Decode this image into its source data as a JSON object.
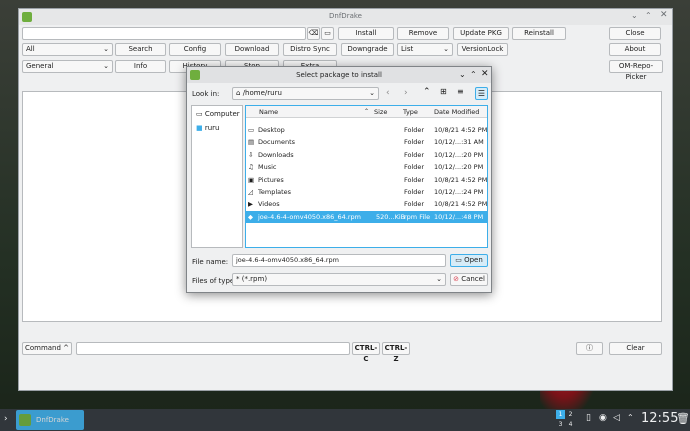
{
  "window": {
    "title": "DnfDrake"
  },
  "toolbar": {
    "install": "Install",
    "remove": "Remove",
    "update_pkg": "Update PKG",
    "reinstall": "Reinstall",
    "close": "Close",
    "about": "About",
    "search": "Search",
    "config": "Config",
    "download": "Download",
    "distro_sync": "Distro Sync",
    "downgrade": "Downgrade",
    "versionlock": "VersionLock",
    "info": "Info",
    "history": "History",
    "stop": "Stop",
    "extra": "Extra",
    "om_repo_picker": "OM-Repo-Picker",
    "filter_all": "All",
    "filter_general": "General",
    "filter_list": "List"
  },
  "bottom": {
    "command": "Command ^",
    "ctrl_c": "CTRL-C",
    "ctrl_z": "CTRL-Z",
    "clear": "Clear"
  },
  "dialog": {
    "title": "Select package to install",
    "look_in_label": "Look in:",
    "look_in_value": "/home/ruru",
    "places": [
      {
        "label": "Computer"
      },
      {
        "label": "ruru"
      }
    ],
    "columns": {
      "name": "Name",
      "size": "Size",
      "type": "Type",
      "date": "Date Modified"
    },
    "files": [
      {
        "name": "Desktop",
        "size": "",
        "type": "Folder",
        "date": "10/8/21 4:52 PM",
        "icon": "desktop-icon"
      },
      {
        "name": "Documents",
        "size": "",
        "type": "Folder",
        "date": "10/12/...:31 AM",
        "icon": "documents-icon"
      },
      {
        "name": "Downloads",
        "size": "",
        "type": "Folder",
        "date": "10/12/...:20 PM",
        "icon": "downloads-icon"
      },
      {
        "name": "Music",
        "size": "",
        "type": "Folder",
        "date": "10/12/...:20 PM",
        "icon": "music-icon"
      },
      {
        "name": "Pictures",
        "size": "",
        "type": "Folder",
        "date": "10/8/21 4:52 PM",
        "icon": "pictures-icon"
      },
      {
        "name": "Templates",
        "size": "",
        "type": "Folder",
        "date": "10/12/...:24 PM",
        "icon": "templates-icon"
      },
      {
        "name": "Videos",
        "size": "",
        "type": "Folder",
        "date": "10/8/21 4:52 PM",
        "icon": "videos-icon"
      },
      {
        "name": "joe-4.6-4-omv4050.x86_64.rpm",
        "size": "520...KiB",
        "type": "rpm File",
        "date": "10/12/...:48 PM",
        "icon": "rpm-file-icon",
        "selected": true
      }
    ],
    "file_name_label": "File name:",
    "file_name_value": "joe-4.6-4-omv4050.x86_64.rpm",
    "files_of_type_label": "Files of type:",
    "files_of_type_value": "* (*.rpm)",
    "open": "Open",
    "cancel": "Cancel"
  },
  "taskbar": {
    "app_label": "DnfDrake",
    "pager": [
      "1",
      "2",
      "3",
      "4"
    ],
    "clock": "12:55"
  },
  "colors": {
    "selection": "#3daee9",
    "taskbar": "#31363b",
    "window_bg": "#eff0f1"
  }
}
